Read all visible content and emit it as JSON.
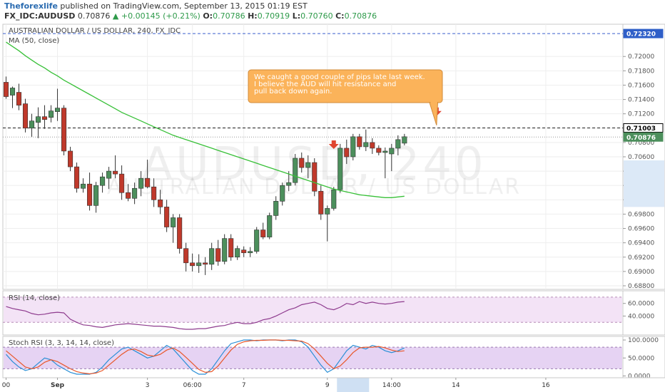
{
  "header": {
    "author": "Theforexlife",
    "published": " published on TradingView.com, September 13, 2015 01:19 EST",
    "symbol": "FX_IDC:AUDUSD",
    "last": "0.70876",
    "change": "▲ +0.00145 (+0.21%)",
    "o_label": "O:",
    "o": "0.70786",
    "h_label": "H:",
    "h": "0.70919",
    "l_label": "L:",
    "l": "0.70760",
    "c_label": "C:",
    "c": "0.70876"
  },
  "colors": {
    "up": "#4c8f5c",
    "down": "#c0392b",
    "ma": "#38c038",
    "rsi": "#8e3b8e",
    "k": "#2a8fd6",
    "d": "#e8572a",
    "note_bg": "#fbb35a"
  },
  "chart_data": [
    {
      "type": "candlestick",
      "title": "AUSTRALIAN DOLLAR / US DOLLAR, 240, FX_IDC",
      "indicator": "MA (50, close)",
      "watermark": "AUDUSD, 240",
      "watermark_sub": "AUSTRALIAN DOLLAR / US DOLLAR",
      "ylim": [
        0.6875,
        0.7245
      ],
      "yticks": [
        "0.72000",
        "0.71800",
        "0.71600",
        "0.71400",
        "0.71200",
        "0.71000",
        "0.70800",
        "0.70600",
        "0.70400",
        "0.70200",
        "0.70000",
        "0.69800",
        "0.69600",
        "0.69400",
        "0.69200",
        "0.69000",
        "0.68800"
      ],
      "xtick_labels": [
        {
          "i": 0,
          "label": "00"
        },
        {
          "i": 8,
          "label": "Sep"
        },
        {
          "i": 22,
          "label": "3"
        },
        {
          "i": 29,
          "label": "06:00"
        },
        {
          "i": 37,
          "label": "7"
        },
        {
          "i": 50,
          "label": "9"
        },
        {
          "i": 60,
          "label": "14:00"
        },
        {
          "i": 70,
          "label": "14"
        },
        {
          "i": 84,
          "label": "16"
        }
      ],
      "highlight_x_range": [
        52,
        56
      ],
      "candles": [
        {
          "o": 0.7164,
          "h": 0.7172,
          "l": 0.7141,
          "c": 0.7144
        },
        {
          "o": 0.7146,
          "h": 0.7158,
          "l": 0.7128,
          "c": 0.7156
        },
        {
          "o": 0.715,
          "h": 0.7162,
          "l": 0.7125,
          "c": 0.7132
        },
        {
          "o": 0.7134,
          "h": 0.7141,
          "l": 0.7094,
          "c": 0.71
        },
        {
          "o": 0.71,
          "h": 0.712,
          "l": 0.7088,
          "c": 0.711
        },
        {
          "o": 0.7108,
          "h": 0.7129,
          "l": 0.7086,
          "c": 0.7116
        },
        {
          "o": 0.7116,
          "h": 0.7132,
          "l": 0.7099,
          "c": 0.7112
        },
        {
          "o": 0.7115,
          "h": 0.7132,
          "l": 0.7108,
          "c": 0.7124
        },
        {
          "o": 0.7123,
          "h": 0.7155,
          "l": 0.711,
          "c": 0.7128
        },
        {
          "o": 0.7128,
          "h": 0.7132,
          "l": 0.7062,
          "c": 0.7068
        },
        {
          "o": 0.7068,
          "h": 0.7074,
          "l": 0.704,
          "c": 0.7046
        },
        {
          "o": 0.7046,
          "h": 0.7052,
          "l": 0.701,
          "c": 0.7016
        },
        {
          "o": 0.7016,
          "h": 0.703,
          "l": 0.701,
          "c": 0.7022
        },
        {
          "o": 0.7022,
          "h": 0.7038,
          "l": 0.6985,
          "c": 0.6992
        },
        {
          "o": 0.6992,
          "h": 0.7025,
          "l": 0.6982,
          "c": 0.702
        },
        {
          "o": 0.702,
          "h": 0.7038,
          "l": 0.701,
          "c": 0.7032
        },
        {
          "o": 0.703,
          "h": 0.7046,
          "l": 0.7015,
          "c": 0.704
        },
        {
          "o": 0.704,
          "h": 0.7062,
          "l": 0.703,
          "c": 0.7036
        },
        {
          "o": 0.7036,
          "h": 0.7048,
          "l": 0.7,
          "c": 0.701
        },
        {
          "o": 0.701,
          "h": 0.7022,
          "l": 0.6998,
          "c": 0.7002
        },
        {
          "o": 0.7002,
          "h": 0.7024,
          "l": 0.6994,
          "c": 0.7016
        },
        {
          "o": 0.7016,
          "h": 0.704,
          "l": 0.7005,
          "c": 0.703
        },
        {
          "o": 0.703,
          "h": 0.7056,
          "l": 0.7016,
          "c": 0.7018
        },
        {
          "o": 0.7018,
          "h": 0.703,
          "l": 0.699,
          "c": 0.7
        },
        {
          "o": 0.7,
          "h": 0.7014,
          "l": 0.698,
          "c": 0.699
        },
        {
          "o": 0.699,
          "h": 0.7,
          "l": 0.6955,
          "c": 0.6962
        },
        {
          "o": 0.6962,
          "h": 0.698,
          "l": 0.694,
          "c": 0.6975
        },
        {
          "o": 0.6975,
          "h": 0.698,
          "l": 0.6925,
          "c": 0.6932
        },
        {
          "o": 0.6932,
          "h": 0.694,
          "l": 0.69,
          "c": 0.6912
        },
        {
          "o": 0.6912,
          "h": 0.6925,
          "l": 0.69,
          "c": 0.6908
        },
        {
          "o": 0.6908,
          "h": 0.6924,
          "l": 0.6898,
          "c": 0.6912
        },
        {
          "o": 0.6912,
          "h": 0.692,
          "l": 0.6895,
          "c": 0.691
        },
        {
          "o": 0.691,
          "h": 0.694,
          "l": 0.6902,
          "c": 0.6932
        },
        {
          "o": 0.6932,
          "h": 0.6944,
          "l": 0.6908,
          "c": 0.6914
        },
        {
          "o": 0.6914,
          "h": 0.6952,
          "l": 0.691,
          "c": 0.6946
        },
        {
          "o": 0.6946,
          "h": 0.6952,
          "l": 0.6915,
          "c": 0.692
        },
        {
          "o": 0.692,
          "h": 0.6936,
          "l": 0.6916,
          "c": 0.6932
        },
        {
          "o": 0.693,
          "h": 0.6935,
          "l": 0.692,
          "c": 0.6926
        },
        {
          "o": 0.6926,
          "h": 0.6934,
          "l": 0.692,
          "c": 0.6928
        },
        {
          "o": 0.6928,
          "h": 0.6962,
          "l": 0.6925,
          "c": 0.6958
        },
        {
          "o": 0.6958,
          "h": 0.6968,
          "l": 0.6945,
          "c": 0.6948
        },
        {
          "o": 0.6948,
          "h": 0.6982,
          "l": 0.6945,
          "c": 0.6978
        },
        {
          "o": 0.6978,
          "h": 0.7005,
          "l": 0.6972,
          "c": 0.6998
        },
        {
          "o": 0.6998,
          "h": 0.7024,
          "l": 0.6992,
          "c": 0.702
        },
        {
          "o": 0.702,
          "h": 0.704,
          "l": 0.7012,
          "c": 0.7024
        },
        {
          "o": 0.7024,
          "h": 0.7064,
          "l": 0.702,
          "c": 0.7058
        },
        {
          "o": 0.7058,
          "h": 0.7066,
          "l": 0.7038,
          "c": 0.7045
        },
        {
          "o": 0.7045,
          "h": 0.7062,
          "l": 0.703,
          "c": 0.7052
        },
        {
          "o": 0.7052,
          "h": 0.7058,
          "l": 0.7005,
          "c": 0.7012
        },
        {
          "o": 0.7012,
          "h": 0.702,
          "l": 0.6972,
          "c": 0.698
        },
        {
          "o": 0.698,
          "h": 0.6992,
          "l": 0.6942,
          "c": 0.6988
        },
        {
          "o": 0.6988,
          "h": 0.7018,
          "l": 0.6985,
          "c": 0.7014
        },
        {
          "o": 0.7014,
          "h": 0.7078,
          "l": 0.701,
          "c": 0.7072
        },
        {
          "o": 0.7072,
          "h": 0.7084,
          "l": 0.705,
          "c": 0.706
        },
        {
          "o": 0.706,
          "h": 0.7092,
          "l": 0.7055,
          "c": 0.7088
        },
        {
          "o": 0.7088,
          "h": 0.7092,
          "l": 0.707,
          "c": 0.7074
        },
        {
          "o": 0.7074,
          "h": 0.7098,
          "l": 0.7068,
          "c": 0.708
        },
        {
          "o": 0.708,
          "h": 0.7086,
          "l": 0.7064,
          "c": 0.7072
        },
        {
          "o": 0.7072,
          "h": 0.7076,
          "l": 0.7062,
          "c": 0.7066
        },
        {
          "o": 0.7066,
          "h": 0.7073,
          "l": 0.703,
          "c": 0.7068
        },
        {
          "o": 0.7064,
          "h": 0.7078,
          "l": 0.704,
          "c": 0.7072
        },
        {
          "o": 0.7072,
          "h": 0.709,
          "l": 0.7062,
          "c": 0.7084
        },
        {
          "o": 0.7079,
          "h": 0.7092,
          "l": 0.7076,
          "c": 0.7088
        }
      ],
      "ma": [
        0.722,
        0.7214,
        0.7208,
        0.7201,
        0.7195,
        0.7189,
        0.7184,
        0.7178,
        0.7173,
        0.7167,
        0.7162,
        0.7157,
        0.7152,
        0.7147,
        0.7142,
        0.7137,
        0.7132,
        0.7127,
        0.7122,
        0.7118,
        0.7114,
        0.711,
        0.7106,
        0.7102,
        0.7098,
        0.7094,
        0.709,
        0.7087,
        0.7084,
        0.7081,
        0.7078,
        0.7075,
        0.7072,
        0.7069,
        0.7066,
        0.7063,
        0.706,
        0.7057,
        0.7054,
        0.7051,
        0.7048,
        0.7045,
        0.7042,
        0.7039,
        0.7036,
        0.7033,
        0.703,
        0.7027,
        0.7024,
        0.7021,
        0.7018,
        0.7015,
        0.7013,
        0.7011,
        0.7009,
        0.7007,
        0.7006,
        0.7005,
        0.7004,
        0.7003,
        0.7003,
        0.7004,
        0.7005
      ],
      "horizontal_lines": [
        0.7232,
        0.71003
      ],
      "price_tags": [
        {
          "value": 0.7232,
          "label": "0.72320",
          "style": "blue"
        },
        {
          "value": 0.71003,
          "label": "0.71003",
          "style": "black"
        },
        {
          "value": 0.70876,
          "label": "0.70876",
          "style": "green"
        }
      ],
      "down_arrows": [
        {
          "i": 51,
          "price": 0.7069
        },
        {
          "i": 67,
          "price": 0.7115
        }
      ],
      "callout": {
        "text": [
          "We caught a good couple of pips late last week.",
          "I believe the AUD will hit resistance and",
          "pull back down again."
        ],
        "points_to": {
          "i": 67,
          "price": 0.7104
        }
      }
    },
    {
      "type": "line",
      "title": "RSI (14, close)",
      "ylim": [
        10,
        80
      ],
      "band": [
        30,
        70
      ],
      "yticks": [
        "60.0000",
        "40.0000"
      ],
      "series": [
        {
          "values": [
            55,
            52,
            50,
            48,
            44,
            42,
            43,
            45,
            46,
            45,
            35,
            30,
            26,
            25,
            23,
            22,
            24,
            26,
            27,
            28,
            27,
            26,
            25,
            24,
            24,
            23,
            22,
            20,
            19,
            19,
            20,
            20,
            22,
            24,
            25,
            28,
            30,
            28,
            28,
            30,
            34,
            36,
            40,
            45,
            50,
            53,
            58,
            60,
            62,
            58,
            52,
            50,
            54,
            60,
            58,
            63,
            60,
            62,
            60,
            59,
            60,
            62,
            63
          ]
        }
      ]
    },
    {
      "type": "line",
      "title": "Stoch RSI (3, 3, 14, 14, close)",
      "ylim": [
        -5,
        110
      ],
      "band": [
        20,
        80
      ],
      "yticks": [
        "100.0000",
        "50.0000",
        "0.0000"
      ],
      "series": [
        {
          "values": [
            60,
            40,
            25,
            15,
            20,
            35,
            50,
            45,
            30,
            20,
            10,
            5,
            5,
            5,
            10,
            25,
            45,
            60,
            75,
            80,
            70,
            60,
            50,
            55,
            70,
            85,
            75,
            55,
            35,
            15,
            5,
            5,
            20,
            45,
            70,
            90,
            95,
            100,
            100,
            98,
            100,
            100,
            100,
            98,
            100,
            100,
            95,
            80,
            55,
            30,
            10,
            20,
            45,
            70,
            85,
            80,
            75,
            85,
            80,
            70,
            65,
            70,
            78
          ]
        },
        {
          "values": [
            70,
            55,
            40,
            25,
            20,
            25,
            38,
            45,
            40,
            30,
            20,
            12,
            8,
            6,
            8,
            15,
            30,
            45,
            60,
            72,
            75,
            68,
            58,
            55,
            60,
            72,
            78,
            68,
            52,
            35,
            18,
            10,
            12,
            28,
            50,
            72,
            88,
            95,
            98,
            99,
            99,
            100,
            100,
            99,
            99,
            98,
            97,
            90,
            75,
            55,
            35,
            20,
            28,
            45,
            65,
            78,
            80,
            80,
            82,
            78,
            72,
            68,
            70
          ]
        }
      ]
    }
  ],
  "xaxis_labels": [
    "00",
    "Sep",
    "3",
    "06:00",
    "7",
    "9",
    "14:00",
    "14",
    "16"
  ]
}
